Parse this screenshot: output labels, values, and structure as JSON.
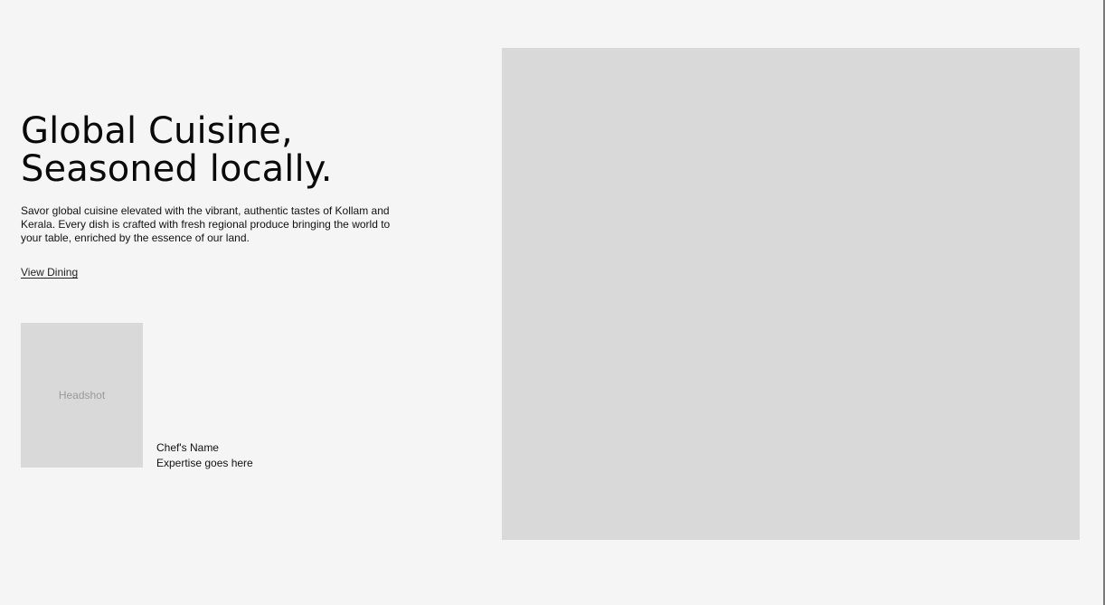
{
  "hero": {
    "title_line1": "Global Cuisine,",
    "title_line2": "Seasoned locally.",
    "description": "Savor global cuisine elevated with the vibrant, authentic tastes of Kollam and Kerala. Every dish is crafted with fresh regional produce bringing the world to your table, enriched by the essence of our land.",
    "cta_label": "View Dining"
  },
  "chef": {
    "headshot_placeholder": "Headshot",
    "name": "Chef's Name",
    "expertise": "Expertise goes here"
  },
  "colors": {
    "background": "#f5f5f5",
    "placeholder": "#d9d9d9",
    "text": "#111111",
    "muted_text": "#9a9a9a"
  }
}
